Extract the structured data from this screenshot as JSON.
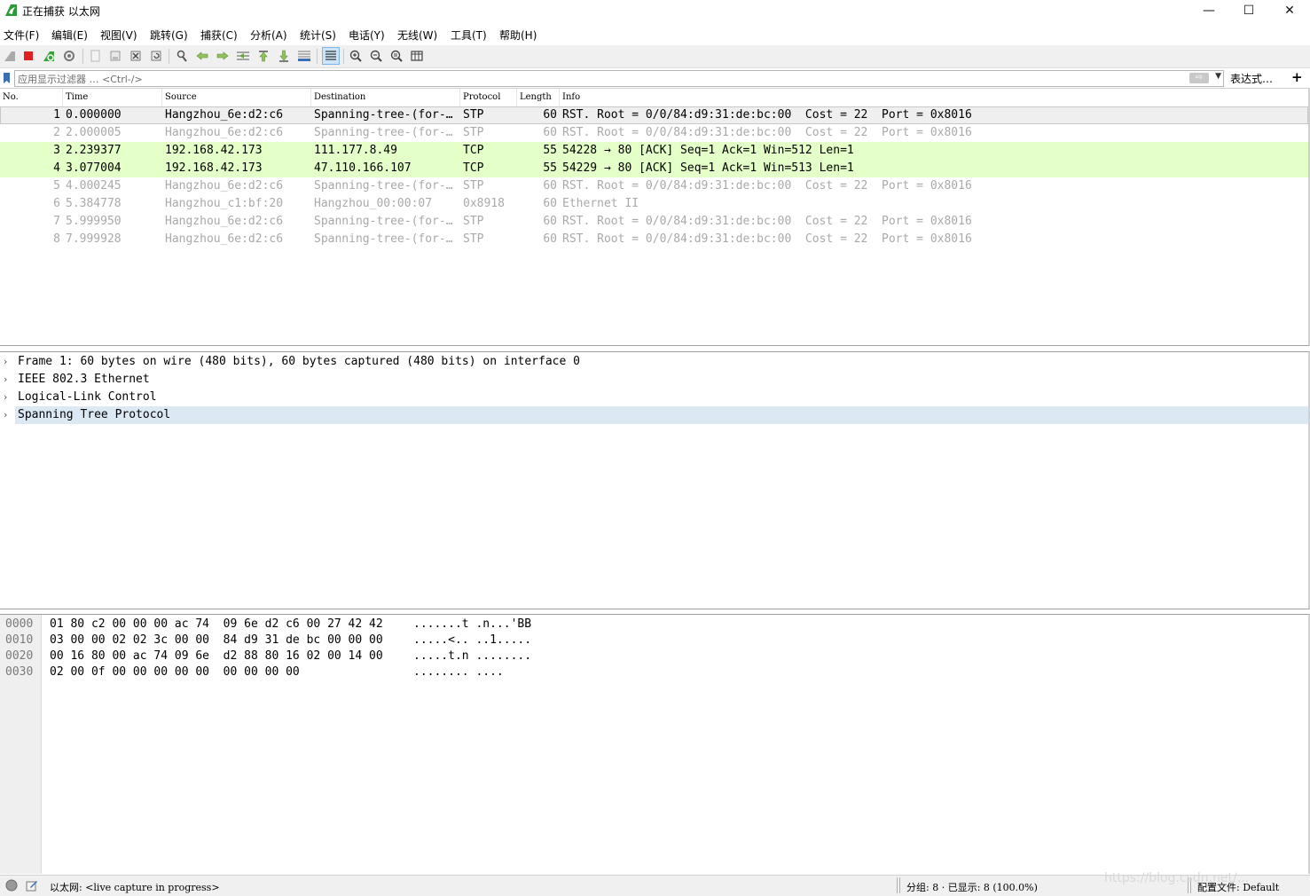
{
  "window": {
    "title": "正在捕获 以太网",
    "minimize": "—",
    "maximize": "☐",
    "close": "✕"
  },
  "menu": [
    "文件(F)",
    "编辑(E)",
    "视图(V)",
    "跳转(G)",
    "捕获(C)",
    "分析(A)",
    "统计(S)",
    "电话(Y)",
    "无线(W)",
    "工具(T)",
    "帮助(H)"
  ],
  "toolbar": {
    "icons": [
      "shark-fin-start-icon",
      "stop-capture-icon",
      "restart-capture-icon",
      "capture-options-icon",
      "open-file-icon",
      "save-file-icon",
      "close-file-icon",
      "reload-file-icon",
      "find-packet-icon",
      "go-back-icon",
      "go-forward-icon",
      "go-to-packet-icon",
      "go-first-packet-icon",
      "go-last-packet-icon",
      "auto-scroll-icon",
      "colorize-icon",
      "zoom-in-icon",
      "zoom-out-icon",
      "normal-size-icon",
      "resize-columns-icon"
    ]
  },
  "filter": {
    "placeholder": "应用显示过滤器 … <Ctrl-/>",
    "apply_arrow": "⇨",
    "dropdown": "▼",
    "expression_label": "表达式…",
    "add_button": "+"
  },
  "packet_list": {
    "columns": [
      "No.",
      "Time",
      "Source",
      "Destination",
      "Protocol",
      "Length",
      "Info"
    ],
    "rows": [
      {
        "no": "1",
        "time": "0.000000",
        "source": "Hangzhou_6e:d2:c6",
        "destination": "Spanning-tree-(for-…",
        "protocol": "STP",
        "length": "60",
        "info": "RST. Root = 0/0/84:d9:31:de:bc:00  Cost = 22  Port = 0x8016",
        "style": "selected"
      },
      {
        "no": "2",
        "time": "2.000005",
        "source": "Hangzhou_6e:d2:c6",
        "destination": "Spanning-tree-(for-…",
        "protocol": "STP",
        "length": "60",
        "info": "RST. Root = 0/0/84:d9:31:de:bc:00  Cost = 22  Port = 0x8016",
        "style": "gray"
      },
      {
        "no": "3",
        "time": "2.239377",
        "source": "192.168.42.173",
        "destination": "111.177.8.49",
        "protocol": "TCP",
        "length": "55",
        "info": "54228 → 80 [ACK] Seq=1 Ack=1 Win=512 Len=1",
        "style": "tcp"
      },
      {
        "no": "4",
        "time": "3.077004",
        "source": "192.168.42.173",
        "destination": "47.110.166.107",
        "protocol": "TCP",
        "length": "55",
        "info": "54229 → 80 [ACK] Seq=1 Ack=1 Win=513 Len=1",
        "style": "tcp"
      },
      {
        "no": "5",
        "time": "4.000245",
        "source": "Hangzhou_6e:d2:c6",
        "destination": "Spanning-tree-(for-…",
        "protocol": "STP",
        "length": "60",
        "info": "RST. Root = 0/0/84:d9:31:de:bc:00  Cost = 22  Port = 0x8016",
        "style": "gray"
      },
      {
        "no": "6",
        "time": "5.384778",
        "source": "Hangzhou_c1:bf:20",
        "destination": "Hangzhou_00:00:07",
        "protocol": "0x8918",
        "length": "60",
        "info": "Ethernet II",
        "style": "gray"
      },
      {
        "no": "7",
        "time": "5.999950",
        "source": "Hangzhou_6e:d2:c6",
        "destination": "Spanning-tree-(for-…",
        "protocol": "STP",
        "length": "60",
        "info": "RST. Root = 0/0/84:d9:31:de:bc:00  Cost = 22  Port = 0x8016",
        "style": "gray"
      },
      {
        "no": "8",
        "time": "7.999928",
        "source": "Hangzhou_6e:d2:c6",
        "destination": "Spanning-tree-(for-…",
        "protocol": "STP",
        "length": "60",
        "info": "RST. Root = 0/0/84:d9:31:de:bc:00  Cost = 22  Port = 0x8016",
        "style": "gray"
      }
    ]
  },
  "details": [
    {
      "text": "Frame 1: 60 bytes on wire (480 bits), 60 bytes captured (480 bits) on interface 0",
      "selected": false
    },
    {
      "text": "IEEE 802.3 Ethernet",
      "selected": false
    },
    {
      "text": "Logical-Link Control",
      "selected": false
    },
    {
      "text": "Spanning Tree Protocol",
      "selected": true
    }
  ],
  "hex": [
    {
      "offset": "0000",
      "bytes": "01 80 c2 00 00 00 ac 74  09 6e d2 c6 00 27 42 42",
      "ascii": ".......t .n...'BB"
    },
    {
      "offset": "0010",
      "bytes": "03 00 00 02 02 3c 00 00  84 d9 31 de bc 00 00 00",
      "ascii": ".....<.. ..1....."
    },
    {
      "offset": "0020",
      "bytes": "00 16 80 00 ac 74 09 6e  d2 88 80 16 02 00 14 00",
      "ascii": ".....t.n ........"
    },
    {
      "offset": "0030",
      "bytes": "02 00 0f 00 00 00 00 00  00 00 00 00",
      "ascii": "........ ...."
    }
  ],
  "status": {
    "interface_text": "以太网: <live capture in progress>",
    "packets_text": "分组: 8 · 已显示: 8 (100.0%)",
    "profile_text": "配置文件: Default"
  },
  "watermark": "https://blog.csdn.net/...",
  "colors": {
    "tcp_row": "#e4ffc7",
    "selected_row": "#efefef",
    "selected_tree": "#dce8f4",
    "gray_text": "#a9a9a9"
  }
}
